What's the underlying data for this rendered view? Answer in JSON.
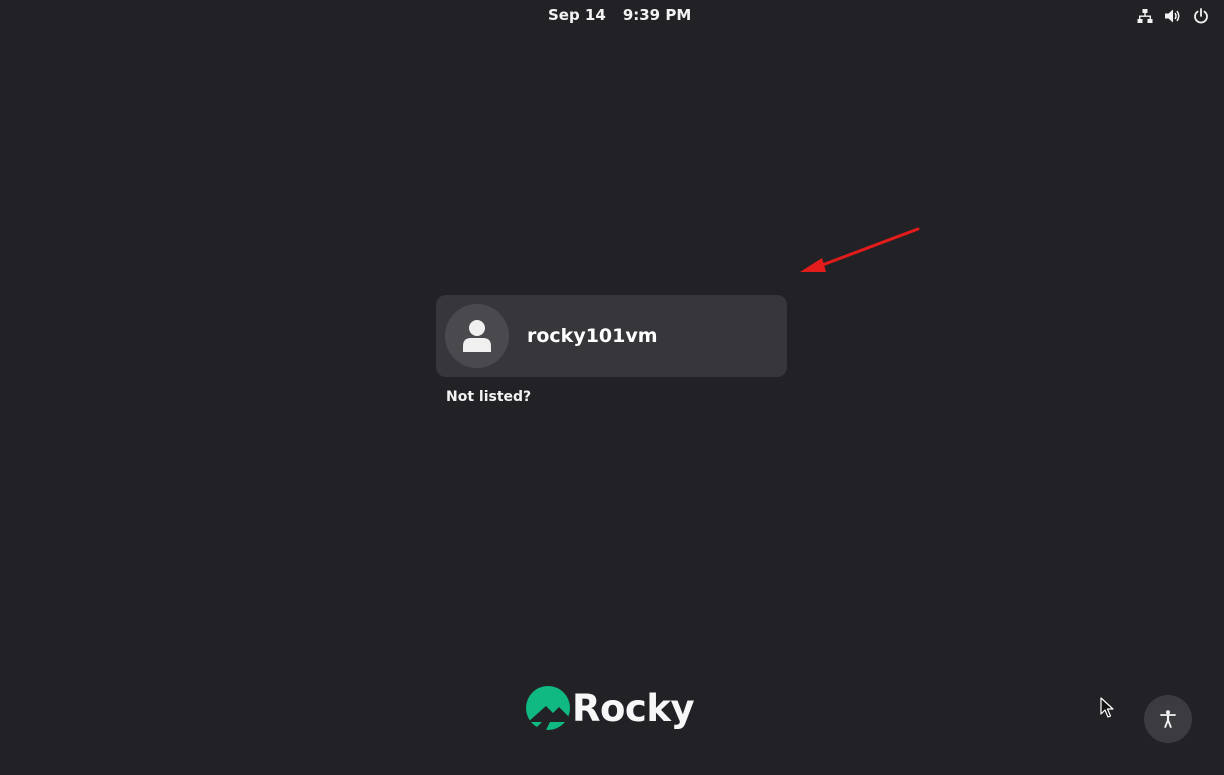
{
  "topbar": {
    "date": "Sep 14",
    "time": "9:39 PM",
    "tray_icons": [
      "network-icon",
      "volume-icon",
      "power-icon"
    ]
  },
  "users": [
    {
      "name": "rocky101vm",
      "avatar_icon": "user-avatar-icon"
    }
  ],
  "not_listed_label": "Not listed?",
  "logo": {
    "wordmark": "Rocky",
    "brand_color": "#10b981"
  },
  "accessibility_icon": "accessibility-icon",
  "colors": {
    "background": "#222226",
    "card": "#37373b",
    "annotation": "#e21b1b"
  }
}
